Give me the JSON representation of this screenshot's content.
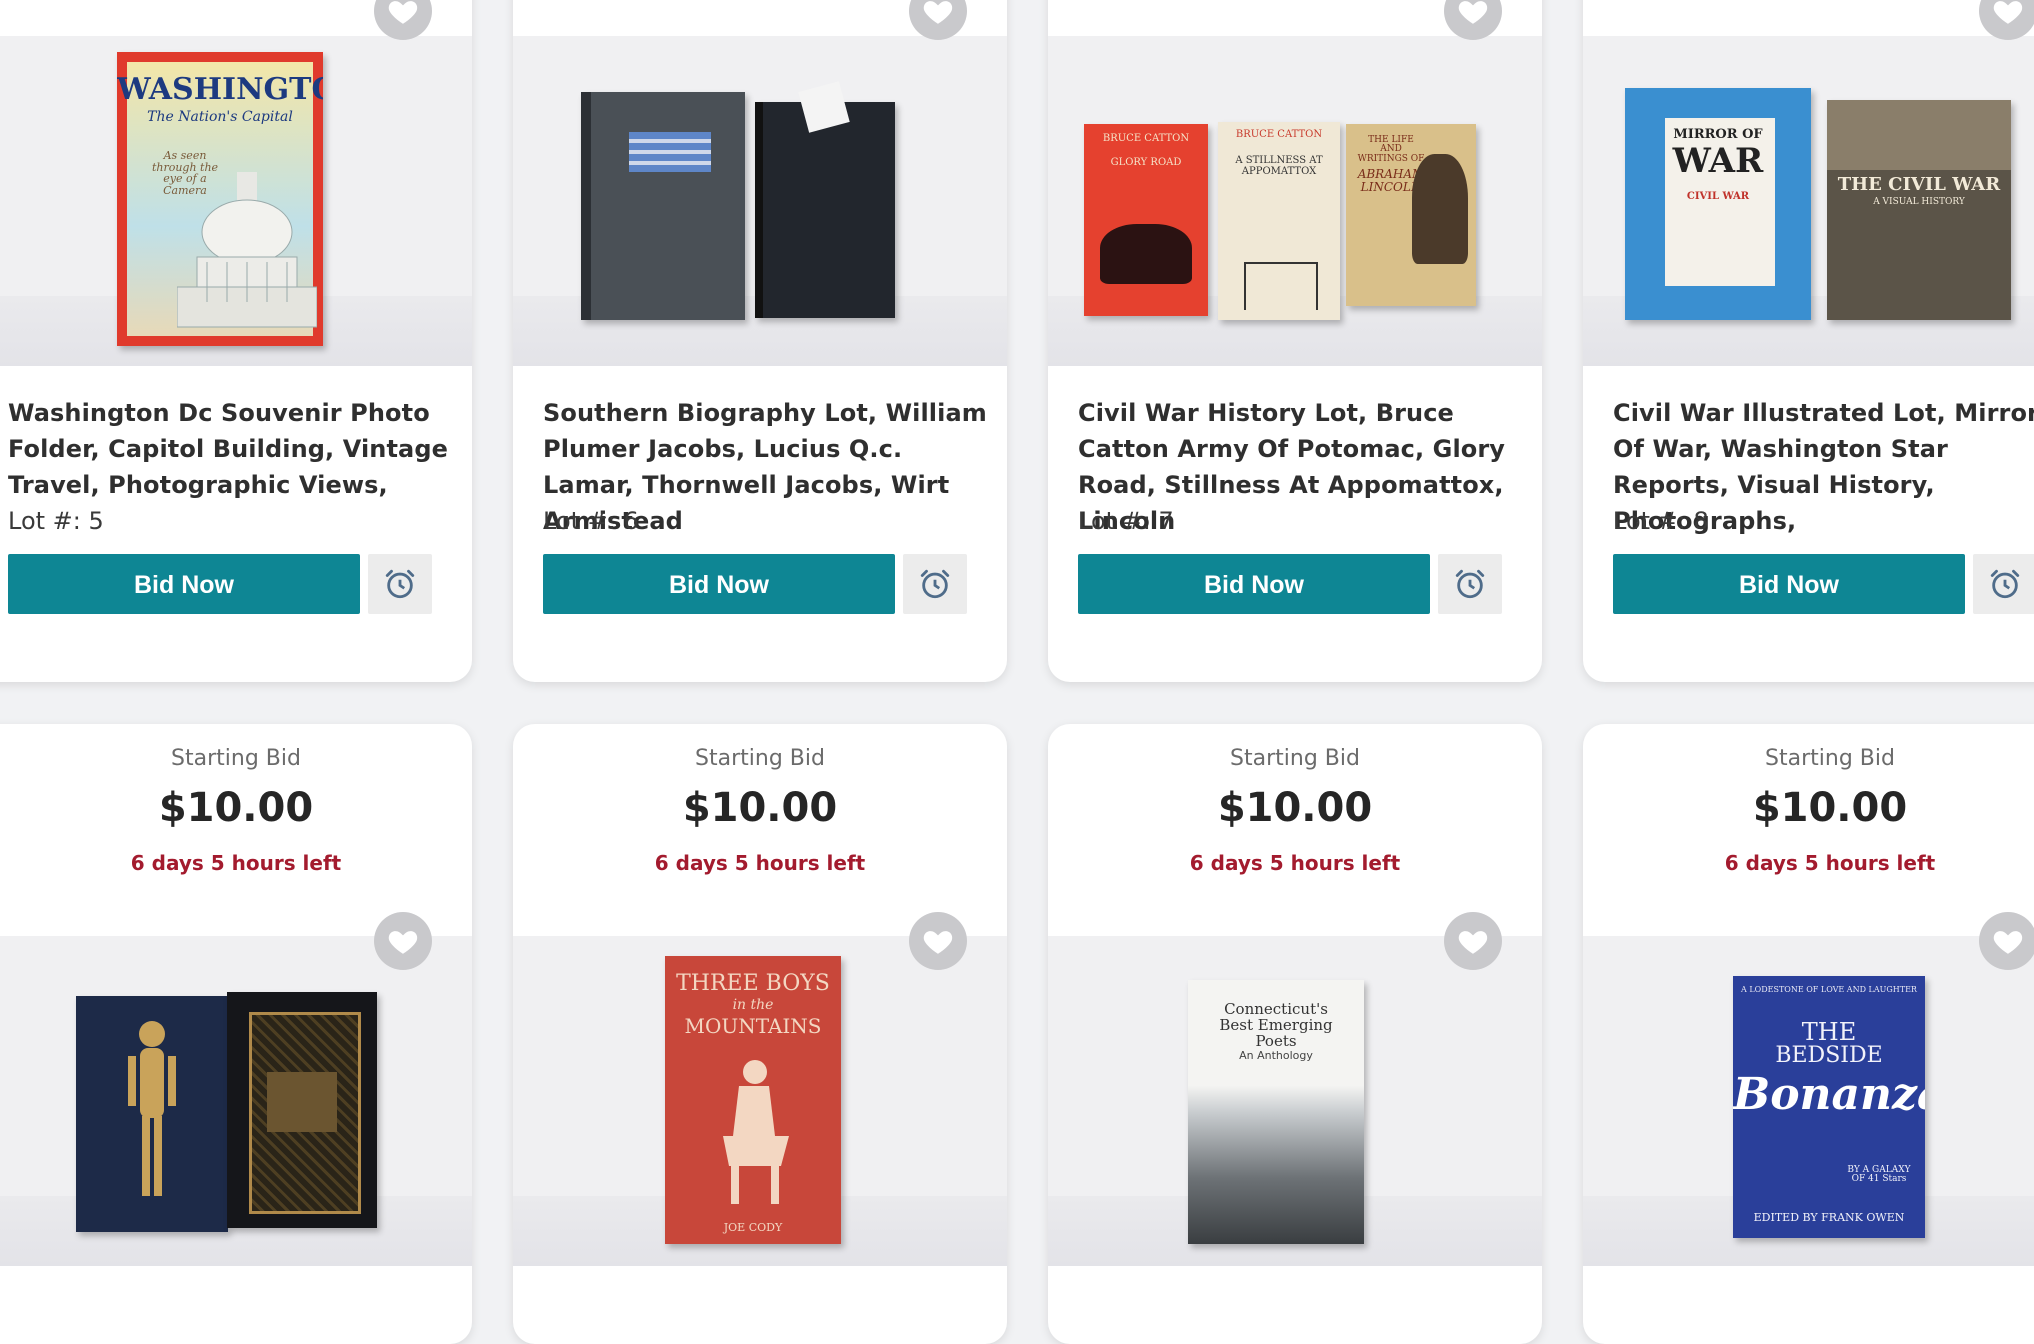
{
  "colors": {
    "bid_button": "#0e8694",
    "time_left": "#a31b2e",
    "favorite_icon_bg": "#c9c9cc"
  },
  "icons": {
    "favorite": "heart-icon",
    "watch": "alarm-clock-icon"
  },
  "cards_row1": [
    {
      "title": "Washington Dc Souvenir Photo Folder, Capitol Building, Vintage Travel, Photographic Views,",
      "lot": "Lot #: 5",
      "bid_label": "Bid Now",
      "photo_text": {
        "line1": "WASHINGTON",
        "line2": "The Nation's Capital",
        "line3": "As seen through the eye of a Camera"
      }
    },
    {
      "title": "Southern Biography Lot, William Plumer Jacobs, Lucius Q.c. Lamar, Thornwell Jacobs, Wirt Armistead",
      "lot": "Lot #: 6",
      "bid_label": "Bid Now"
    },
    {
      "title": "Civil War History Lot, Bruce Catton Army Of Potomac, Glory Road, Stillness At Appomattox, Lincoln",
      "lot": "Lot #: 7",
      "bid_label": "Bid Now",
      "photo_text": {
        "b1a": "BRUCE CATTON",
        "b1b": "GLORY ROAD",
        "b2a": "BRUCE CATTON",
        "b2b": "A STILLNESS AT APPOMATTOX",
        "b3a": "THE LIFE AND WRITINGS OF",
        "b3b": "ABRAHAM LINCOLN"
      }
    },
    {
      "title": "Civil War Illustrated Lot, Mirror Of War, Washington Star Reports, Visual History, Photographs,",
      "lot": "Lot #: 8",
      "bid_label": "Bid Now",
      "photo_text": {
        "b1a": "MIRROR OF",
        "b1b": "WAR",
        "b1c": "CIVIL WAR",
        "b2a": "THE CIVIL WAR",
        "b2b": "A VISUAL HISTORY"
      }
    }
  ],
  "cards_row2": [
    {
      "starting_bid_label": "Starting Bid",
      "amount": "$10.00",
      "time_left": "6 days 5 hours left"
    },
    {
      "starting_bid_label": "Starting Bid",
      "amount": "$10.00",
      "time_left": "6 days 5 hours left",
      "photo_text": {
        "line1": "THREE BOYS",
        "line2": "in the",
        "line3": "MOUNTAINS",
        "line4": "JOE CODY"
      }
    },
    {
      "starting_bid_label": "Starting Bid",
      "amount": "$10.00",
      "time_left": "6 days 5 hours left",
      "photo_text": {
        "line1": "Connecticut's Best Emerging Poets",
        "line2": "An Anthology"
      }
    },
    {
      "starting_bid_label": "Starting Bid",
      "amount": "$10.00",
      "time_left": "6 days 5 hours left",
      "photo_text": {
        "line1": "A LODESTONE OF LOVE AND LAUGHTER",
        "line2": "THE",
        "line3": "BEDSIDE",
        "line4": "Bonanza",
        "line5": "BY A GALAXY OF 41 Stars",
        "line6": "EDITED BY FRANK OWEN"
      }
    }
  ]
}
